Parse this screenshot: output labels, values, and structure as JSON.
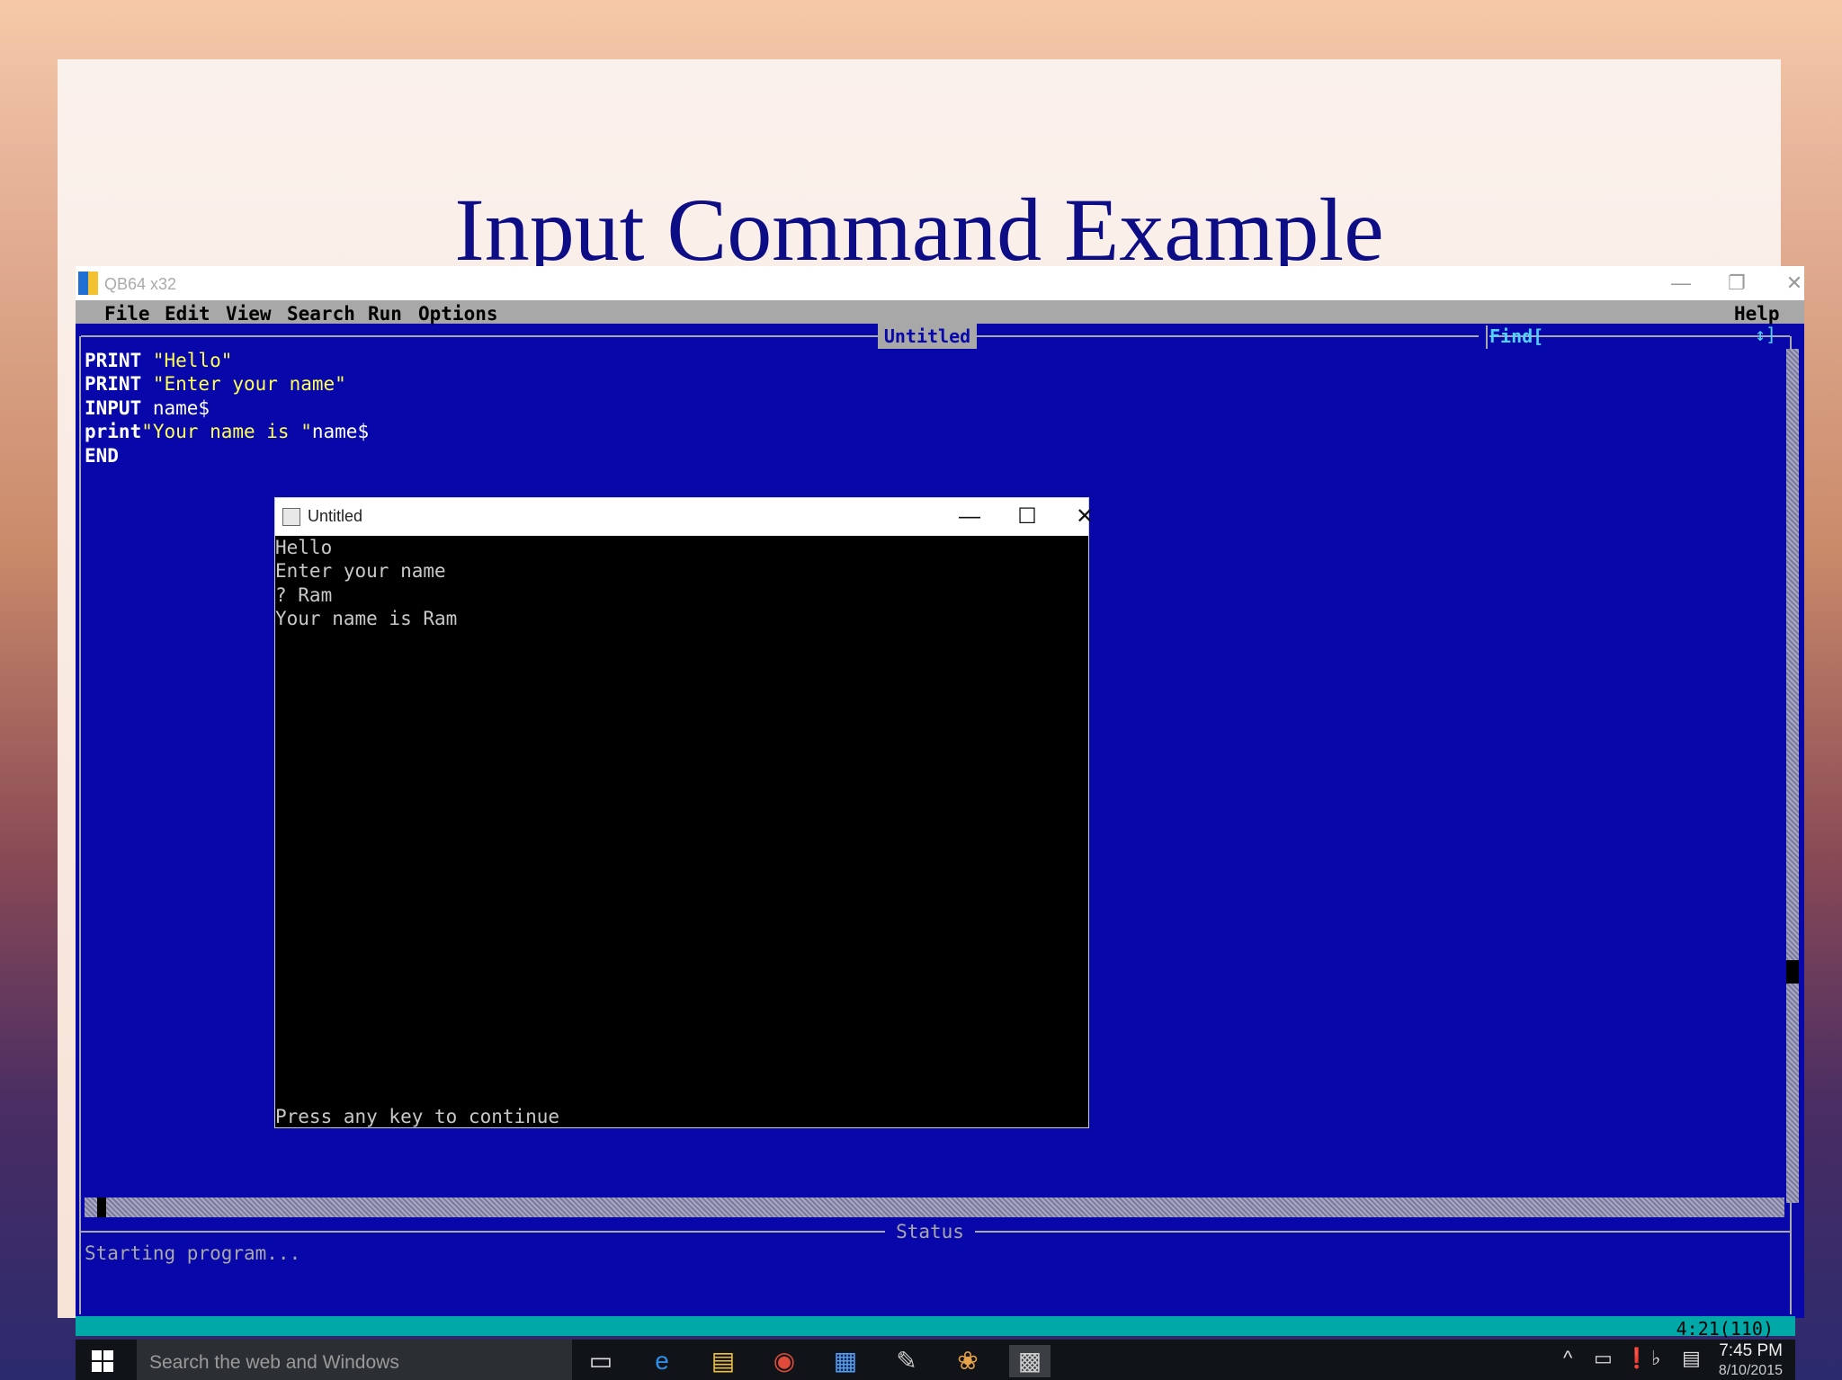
{
  "slide": {
    "title": "Input Command Example"
  },
  "ide": {
    "window_title": "QB64 x32",
    "window_buttons": {
      "minimize": "—",
      "restore": "❐",
      "close": "✕"
    },
    "menu": [
      "File",
      "Edit",
      "View",
      "Search",
      "Run",
      "Options"
    ],
    "help": "Help",
    "tab_title": "Untitled",
    "find_label": "Find[",
    "find_arrows": "↕]",
    "code_lines": [
      [
        {
          "t": "PRINT ",
          "c": "kw"
        },
        {
          "t": "\"Hello\"",
          "c": "str"
        }
      ],
      [
        {
          "t": "PRINT ",
          "c": "kw"
        },
        {
          "t": "\"Enter your name\"",
          "c": "str"
        }
      ],
      [
        {
          "t": "INPUT ",
          "c": "kw"
        },
        {
          "t": "name$",
          "c": "id"
        }
      ],
      [
        {
          "t": "print",
          "c": "kw"
        },
        {
          "t": "\"Your name is \"",
          "c": "str"
        },
        {
          "t": "name$",
          "c": "id"
        }
      ],
      [
        {
          "t": "END",
          "c": "kw"
        }
      ]
    ],
    "status_label": "Status",
    "status_text": "Starting program...",
    "cursor_position": "4:21(110)"
  },
  "run_window": {
    "title": "Untitled",
    "buttons": {
      "minimize": "—",
      "maximize": "☐",
      "close": "✕"
    },
    "output_lines": [
      "Hello",
      "Enter your name",
      "? Ram",
      "Your name is Ram"
    ],
    "continue_text": "Press any key to continue"
  },
  "taskbar": {
    "search_placeholder": "Search the web and Windows",
    "apps": [
      "task-view",
      "edge",
      "file-explorer",
      "chrome",
      "qb64",
      "app-6",
      "paint",
      "app-8"
    ],
    "time": "7:45 PM",
    "date": "8/10/2015"
  },
  "colors": {
    "ide_bg": "#0808aa",
    "ide_string": "#ffff54",
    "ide_find": "#52d0ff",
    "ide_statusbar": "#00a8a8",
    "slide_title": "#0d0d86"
  }
}
